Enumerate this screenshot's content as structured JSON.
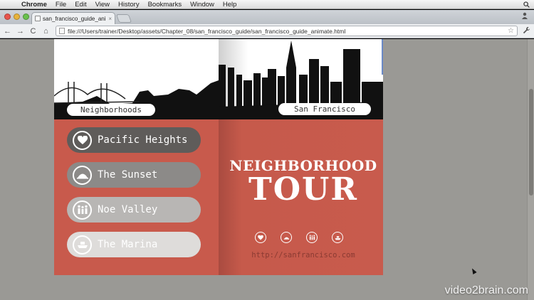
{
  "menubar": {
    "apple_icon": "apple-icon",
    "items": [
      "Chrome",
      "File",
      "Edit",
      "View",
      "History",
      "Bookmarks",
      "Window",
      "Help"
    ]
  },
  "browser": {
    "tab_title": "san_francisco_guide_animate",
    "tab_close": "×",
    "url": "file:///Users/trainer/Desktop/assets/Chapter_08/san_francisco_guide/san_francisco_guide_animate.html",
    "back": "←",
    "forward": "→",
    "reload": "C",
    "home": "⌂",
    "star": "☆",
    "wrench": "🔧"
  },
  "page": {
    "left_label": "Neighborhoods",
    "right_label": "San Francisco",
    "neighborhoods": [
      {
        "label": "Pacific Heights",
        "icon": "heart-icon"
      },
      {
        "label": "The Sunset",
        "icon": "sun-icon"
      },
      {
        "label": "Noe Valley",
        "icon": "family-icon"
      },
      {
        "label": "The Marina",
        "icon": "boat-icon"
      }
    ],
    "title_line1": "NEIGHBORHOOD",
    "title_line2": "TOUR",
    "url": "http://sanfrancisco.com"
  },
  "watermark": "video2brain.com",
  "colors": {
    "brick": "#c85a4c",
    "dark_pill": "#5f5c5a",
    "page_bg": "#9a9995"
  }
}
